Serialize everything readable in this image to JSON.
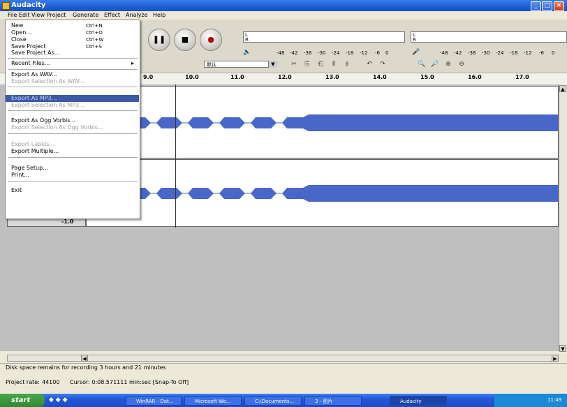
{
  "window": {
    "title": "Audacity"
  },
  "menubar": [
    "File",
    "Edit",
    "View",
    "Project",
    "Generate",
    "Effect",
    "Analyze",
    "Help"
  ],
  "filemenu": {
    "items": [
      {
        "label": "New",
        "shortcut": "Ctrl+N"
      },
      {
        "label": "Open...",
        "shortcut": "Ctrl+O"
      },
      {
        "label": "Close",
        "shortcut": "Ctrl+W"
      },
      {
        "label": "Save Project",
        "shortcut": "Ctrl+S"
      },
      {
        "label": "Save Project As..."
      },
      {
        "label": "Recent Files..."
      },
      {
        "label": "Export As WAV..."
      },
      {
        "label": "Export Selection As WAV..."
      },
      {
        "label": "Export As MP3..."
      },
      {
        "label": "Export Selection As MP3..."
      },
      {
        "label": "Export As Ogg Vorbis..."
      },
      {
        "label": "Export Selection As Ogg Vorbis..."
      },
      {
        "label": "Export Labels..."
      },
      {
        "label": "Export Multiple..."
      },
      {
        "label": "Page Setup..."
      },
      {
        "label": "Print..."
      },
      {
        "label": "Exit"
      }
    ],
    "highlighted": "Export As MP3...",
    "submenu_arrow": "▸"
  },
  "toolbar": {
    "transport": [
      {
        "name": "pause",
        "glyph": "❚❚"
      },
      {
        "name": "stop",
        "glyph": "■"
      },
      {
        "name": "record",
        "glyph": "●"
      }
    ],
    "meter_l": "L",
    "meter_r": "R",
    "scale_values": [
      "-48",
      "-42",
      "-36",
      "-30",
      "-24",
      "-18",
      "-12",
      "-6",
      "0"
    ],
    "edit_tools": [
      "✂",
      "⎘",
      "⎗",
      "⫴",
      "⫵",
      "↶",
      "↷"
    ],
    "zoom_tools": [
      "🔍",
      "🔎",
      "⊕",
      "⊖"
    ],
    "combo_value": "默认"
  },
  "timeline": {
    "ticks": [
      "9.0",
      "10.0",
      "11.0",
      "12.0",
      "13.0",
      "14.0",
      "15.0",
      "16.0",
      "17.0"
    ]
  },
  "track2": {
    "gain_label": "-1.0"
  },
  "status": {
    "disk": "Disk space remains for recording 3 hours and 21 minutes",
    "project_rate_label": "Project rate:",
    "project_rate": "44100",
    "cursor": "Cursor: 0:08.571111 min:sec  [Snap-To Off]"
  },
  "taskbar": {
    "start": "start",
    "buttons": [
      "WinRAR - Dat...",
      "Microsoft Wo...",
      "C:\\Documents...",
      "3 - 图片",
      "Audacity"
    ],
    "clock": "11:49"
  },
  "colors": {
    "waveform": "#4a66c8",
    "menu_highlight": "#3c5aa8",
    "title_bar": "#1c5ed6"
  }
}
